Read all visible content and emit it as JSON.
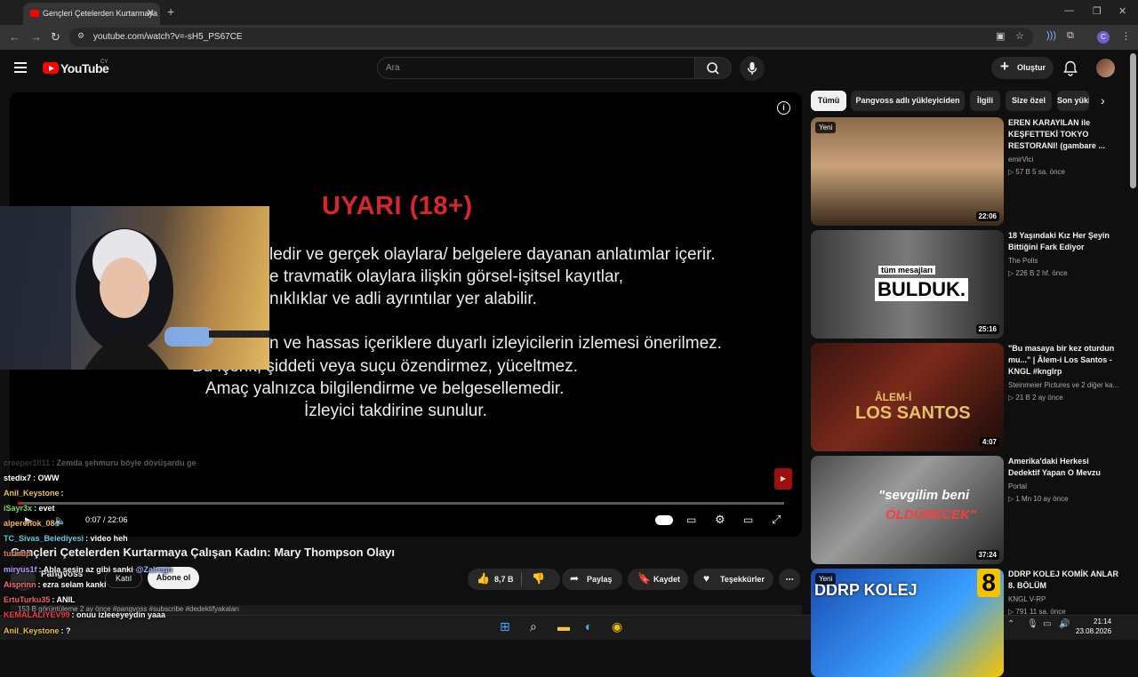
{
  "browser": {
    "tab_title": "Gençleri Çetelerden Kurtarmaya",
    "url": "youtube.com/watch?v=-sH5_PS67CE",
    "profile_initial": "C"
  },
  "header": {
    "logo_text": "YouTube",
    "country": "CY",
    "search_placeholder": "Ara",
    "create_label": "Oluştur"
  },
  "player": {
    "warning_title": "UYARI (18+)",
    "warning_lines": [
      "ledir ve gerçek olaylara/ belgelere dayanan anlatımlar içerir.",
      "e travmatik olaylara ilişkin görsel-işitsel kayıtlar,",
      "nıklıklar ve adli ayrıntılar yer alabilir.",
      "n ve hassas içeriklere duyarlı izleyicilerin izlemesi önerilmez.",
      "Bu içerik, şiddeti veya suçu özendirmez, yüceltmez.",
      "Amaç yalnızca bilgilendirme ve belgesellemedir.",
      "İzleyici takdirine sunulur."
    ],
    "time": "0:07 / 22:06",
    "progress": 0.005
  },
  "chat": [
    {
      "user": "creeper1011",
      "text": ": Zemda şehmuru böyle dövüşardu ge",
      "color": "#9a9a9a",
      "dim": true
    },
    {
      "user": "stedix7",
      "text": ": OWW",
      "color": "#ffffff"
    },
    {
      "user": "Anil_Keystone",
      "text": ":",
      "color": "#e8c14a"
    },
    {
      "user": "iSayr3x",
      "text": ": evet",
      "color": "#7ddc5a"
    },
    {
      "user": "alperenok_08",
      "text": ":",
      "color": "#ffb347"
    },
    {
      "user": "TC_Sivas_Belediyesi",
      "text": ": video heh",
      "color": "#5ad0e0"
    },
    {
      "user": "turkmp",
      "text": "",
      "color": "#e07a5a"
    },
    {
      "user": "miryus1f",
      "text": ": Abla sesin az gibi sanki",
      "color": "#b49cff",
      "mention": "@Zalregn"
    },
    {
      "user": "Aisprinn",
      "text": ": ezra selam kanki",
      "color": "#ff6b6b"
    },
    {
      "user": "ErtuTurku35",
      "text": ": ANIL",
      "color": "#ff5c5c"
    },
    {
      "user": "KEMALALIYEV99",
      "text": ": onuu izleeeyeydin yaaa",
      "color": "#ff3b3b"
    },
    {
      "user": "Anil_Keystone",
      "text": ": ?",
      "color": "#e8c14a"
    }
  ],
  "video": {
    "title": "Gençleri Çetelerden Kurtarmaya Çalışan Kadın: Mary Thompson Olayı",
    "channel": "Pangvoss",
    "join_label": "Katıl",
    "subscribe_label": "Abone ol",
    "likes": "8,7 B",
    "share_label": "Paylaş",
    "save_label": "Kaydet",
    "thanks_label": "Teşekkürler",
    "description_line": "153 B görüntüleme  2 ay önce  #pangvoss #subscribe #dedektifyakaları"
  },
  "chips": [
    "Tümü",
    "Pangvoss adlı yükleyiciden",
    "İlgili",
    "Size özel",
    "Son yükle"
  ],
  "recommendations": [
    {
      "title": "EREN KARAYILAN ile KEŞFETTEKİ TOKYO RESTORANI! (gambare ...",
      "channel": "emirVici",
      "meta": "▷ 57 B  5 sa. önce",
      "duration": "22:06",
      "badge": "Yeni"
    },
    {
      "title": "18 Yaşındaki Kız Her Şeyin Bittiğini Fark Ediyor",
      "channel": "The Polis",
      "meta": "▷ 226 B  2 hf. önce",
      "duration": "25:16",
      "thumb_small": "tüm mesajları",
      "thumb_big": "BULDUK."
    },
    {
      "title": "\"Bu masaya bir kez oturdun mu...\" | Âlem-i Los Santos - KNGL #knglrp",
      "channel": "Steinmeier Pictures ve 2 diğer ka...",
      "meta": "▷ 21 B  2 ay önce",
      "duration": "4:07",
      "thumb_small": "ÂLEM-İ",
      "thumb_big": "LOS SANTOS"
    },
    {
      "title": "Amerika'daki Herkesi Dedektif Yapan O Mevzu",
      "channel": "Portal",
      "meta": "▷ 1 Mn  10 ay önce",
      "duration": "37:24",
      "thumb_small": "\"sevgilim beni",
      "thumb_big": "ÖLDÜRECEK\""
    },
    {
      "title": "DDRP KOLEJ KOMİK ANLAR 8. BÖLÜM",
      "channel": "KNGL V-RP",
      "meta": "▷ 791  11 sa. önce",
      "badge": "Yeni",
      "thumb_big": "DDRP KOLEJ",
      "thumb_num": "8"
    }
  ],
  "taskbar": {
    "time": "21:14",
    "date": "23.08.2026"
  }
}
